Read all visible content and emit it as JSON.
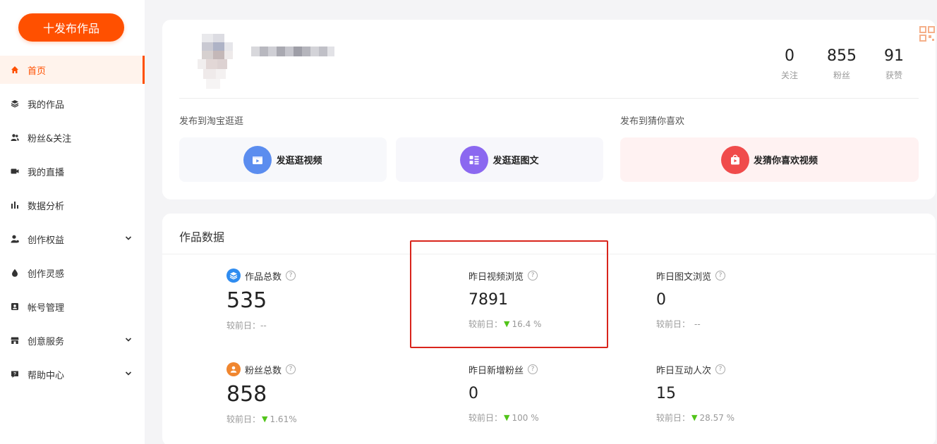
{
  "sidebar": {
    "publish_button": "十发布作品",
    "items": [
      {
        "label": "首页",
        "icon": "home-icon",
        "active": true
      },
      {
        "label": "我的作品",
        "icon": "layers-icon"
      },
      {
        "label": "粉丝&关注",
        "icon": "users-icon"
      },
      {
        "label": "我的直播",
        "icon": "video-camera-icon"
      },
      {
        "label": "数据分析",
        "icon": "bar-chart-icon"
      },
      {
        "label": "创作权益",
        "icon": "user-badge-icon",
        "expandable": true
      },
      {
        "label": "创作灵感",
        "icon": "droplet-icon"
      },
      {
        "label": "帐号管理",
        "icon": "id-card-icon"
      },
      {
        "label": "创意服务",
        "icon": "store-icon",
        "expandable": true
      },
      {
        "label": "帮助中心",
        "icon": "help-chat-icon",
        "expandable": true
      }
    ]
  },
  "profile": {
    "stats": [
      {
        "value": "0",
        "label": "关注"
      },
      {
        "value": "855",
        "label": "粉丝"
      },
      {
        "value": "91",
        "label": "获赞"
      }
    ],
    "publish_taobao_label": "发布到淘宝逛逛",
    "publish_guess_label": "发布到猜你喜欢",
    "buttons": [
      {
        "label": "发逛逛视频",
        "icon": "video-clapper-icon",
        "color": "#5b8def"
      },
      {
        "label": "发逛逛图文",
        "icon": "image-text-icon",
        "color": "#8b68f0"
      },
      {
        "label": "发猜你喜欢视频",
        "icon": "shopping-bag-play-icon",
        "color": "#f04b4b"
      }
    ]
  },
  "data_section": {
    "title": "作品数据",
    "compare_label": "较前日：",
    "metrics": [
      {
        "title": "作品总数",
        "value": "535",
        "compare": "--",
        "trend": "none",
        "icon": "layers-icon",
        "icon_color": "#2f8cf0"
      },
      {
        "title": "昨日视频浏览",
        "value": "7891",
        "compare": "16.4 %",
        "trend": "down"
      },
      {
        "title": "昨日图文浏览",
        "value": "0",
        "compare": "--",
        "trend": "none"
      },
      {
        "title": "粉丝总数",
        "value": "858",
        "compare": "1.61%",
        "trend": "down",
        "icon": "user-icon",
        "icon_color": "#f0862f"
      },
      {
        "title": "昨日新增粉丝",
        "value": "0",
        "compare": "100 %",
        "trend": "down"
      },
      {
        "title": "昨日互动人次",
        "value": "15",
        "compare": "28.57 %",
        "trend": "down"
      }
    ]
  },
  "colors": {
    "accent": "#ff5000",
    "trend_down": "#52c41a",
    "highlight_box": "#d9251c"
  }
}
